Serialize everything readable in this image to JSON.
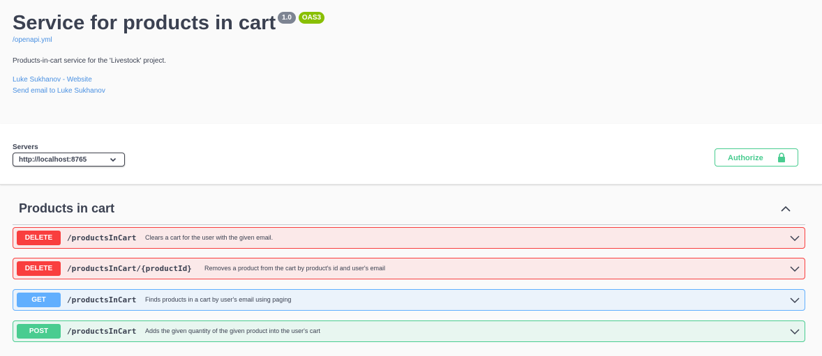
{
  "info": {
    "title": "Service for products in cart",
    "version": "1.0",
    "oas_badge": "OAS3",
    "spec_link": "/openapi.yml",
    "description": "Products-in-cart service for the 'Livestock' project.",
    "contact_website": "Luke Sukhanov - Website",
    "contact_email": "Send email to Luke Sukhanov"
  },
  "servers": {
    "label": "Servers",
    "selected": "http://localhost:8765"
  },
  "authorize": {
    "label": "Authorize",
    "icon": "lock-icon"
  },
  "tag": {
    "name": "Products in cart",
    "expanded": true
  },
  "operations": [
    {
      "method": "DELETE",
      "path": "/productsInCart",
      "summary": "Clears a cart for the user with the given email."
    },
    {
      "method": "DELETE",
      "path": "/productsInCart/{productId}",
      "summary": "Removes a product from the cart by product's id and user's email"
    },
    {
      "method": "GET",
      "path": "/productsInCart",
      "summary": "Finds products in a cart by user's email using paging"
    },
    {
      "method": "POST",
      "path": "/productsInCart",
      "summary": "Adds the given quantity of the given product into the user's cart"
    }
  ],
  "colors": {
    "delete": "#f93e3e",
    "delete_bg": "#fbe9e9",
    "get": "#61affe",
    "get_bg": "#ebf3fb",
    "post": "#49cc90",
    "post_bg": "#e8f6f0",
    "link": "#4990e2",
    "version_badge": "#7d8492",
    "oas_badge": "#89bf04"
  }
}
